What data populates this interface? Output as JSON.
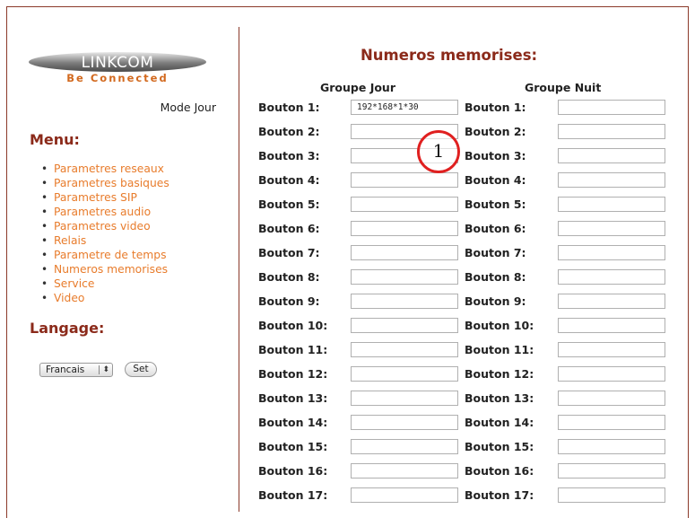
{
  "logo": {
    "brand": "LINKCOM",
    "tagline": "Be Connected"
  },
  "mode": "Mode Jour",
  "menu": {
    "title": "Menu:",
    "items": [
      "Parametres reseaux",
      "Parametres basiques",
      "Parametres SIP",
      "Parametres audio",
      "Parametres video",
      "Relais",
      "Parametre de temps",
      "Numeros memorises",
      "Service",
      "Video"
    ]
  },
  "language": {
    "title": "Langage:",
    "selected": "Francais",
    "set_label": "Set"
  },
  "main": {
    "title": "Numeros memorises:",
    "group_day": "Groupe Jour",
    "group_night": "Groupe Nuit",
    "rows": [
      {
        "label": "Bouton 1:",
        "day": "192*168*1*30",
        "night": ""
      },
      {
        "label": "Bouton 2:",
        "day": "",
        "night": ""
      },
      {
        "label": "Bouton 3:",
        "day": "",
        "night": ""
      },
      {
        "label": "Bouton 4:",
        "day": "",
        "night": ""
      },
      {
        "label": "Bouton 5:",
        "day": "",
        "night": ""
      },
      {
        "label": "Bouton 6:",
        "day": "",
        "night": ""
      },
      {
        "label": "Bouton 7:",
        "day": "",
        "night": ""
      },
      {
        "label": "Bouton 8:",
        "day": "",
        "night": ""
      },
      {
        "label": "Bouton 9:",
        "day": "",
        "night": ""
      },
      {
        "label": "Bouton 10:",
        "day": "",
        "night": ""
      },
      {
        "label": "Bouton 11:",
        "day": "",
        "night": ""
      },
      {
        "label": "Bouton 12:",
        "day": "",
        "night": ""
      },
      {
        "label": "Bouton 13:",
        "day": "",
        "night": ""
      },
      {
        "label": "Bouton 14:",
        "day": "",
        "night": ""
      },
      {
        "label": "Bouton 15:",
        "day": "",
        "night": ""
      },
      {
        "label": "Bouton 16:",
        "day": "",
        "night": ""
      },
      {
        "label": "Bouton 17:",
        "day": "",
        "night": ""
      }
    ]
  },
  "annotation": {
    "number": "1",
    "color": "#e02020"
  },
  "colors": {
    "accent": "#8b2a1a",
    "menu_link": "#e87c2c"
  }
}
